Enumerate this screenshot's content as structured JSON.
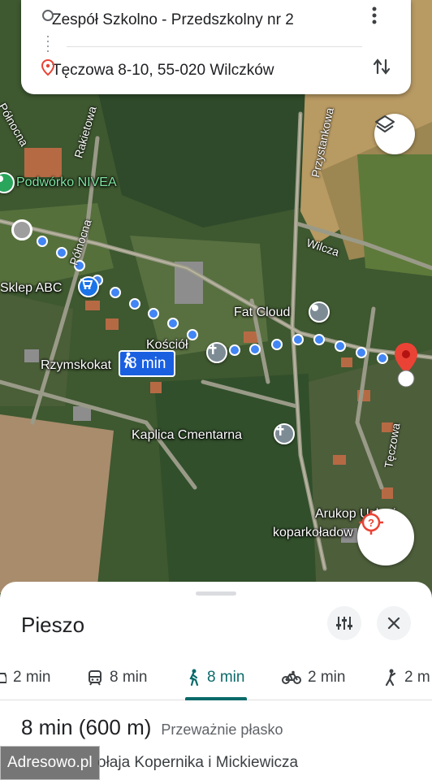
{
  "route": {
    "origin": "Zespół Szkolno - Przedszkolny nr 2",
    "destination": "Tęczowa 8-10, 55-020 Wilczków"
  },
  "map": {
    "streets": [
      "Północna",
      "Rakietowa",
      "Północna",
      "Przystankowa",
      "Wilcza",
      "Tęczowa"
    ],
    "places": {
      "podworko": "Podwórko NIVEA",
      "sklep": "Sklep ABC",
      "kosciol": "Kościół",
      "rzymskokat": "Rzymskokat",
      "fat_cloud": "Fat Cloud",
      "kaplica": "Kaplica Cmentarna",
      "arukop": "Arukop Usługi",
      "koparko": "koparkoładow"
    },
    "walk_time": "8 min"
  },
  "sheet": {
    "title": "Pieszo",
    "modes": [
      {
        "icon": "car-icon",
        "label": "2 min"
      },
      {
        "icon": "transit-icon",
        "label": "8 min"
      },
      {
        "icon": "walk-icon",
        "label": "8 min",
        "active": true
      },
      {
        "icon": "bike-icon",
        "label": "2 min"
      },
      {
        "icon": "ride-icon",
        "label": "2 m"
      }
    ],
    "summary_time": "8 min (600 m)",
    "summary_note": "Przeważnie płasko",
    "via": "ołaja Kopernika i Mickiewicza"
  },
  "watermark": "Adresowo.pl",
  "colors": {
    "route_dot": "#4285f4",
    "accent": "#0b6a6a",
    "chip": "#1a5fe0",
    "destination_pin": "#ea4335"
  }
}
